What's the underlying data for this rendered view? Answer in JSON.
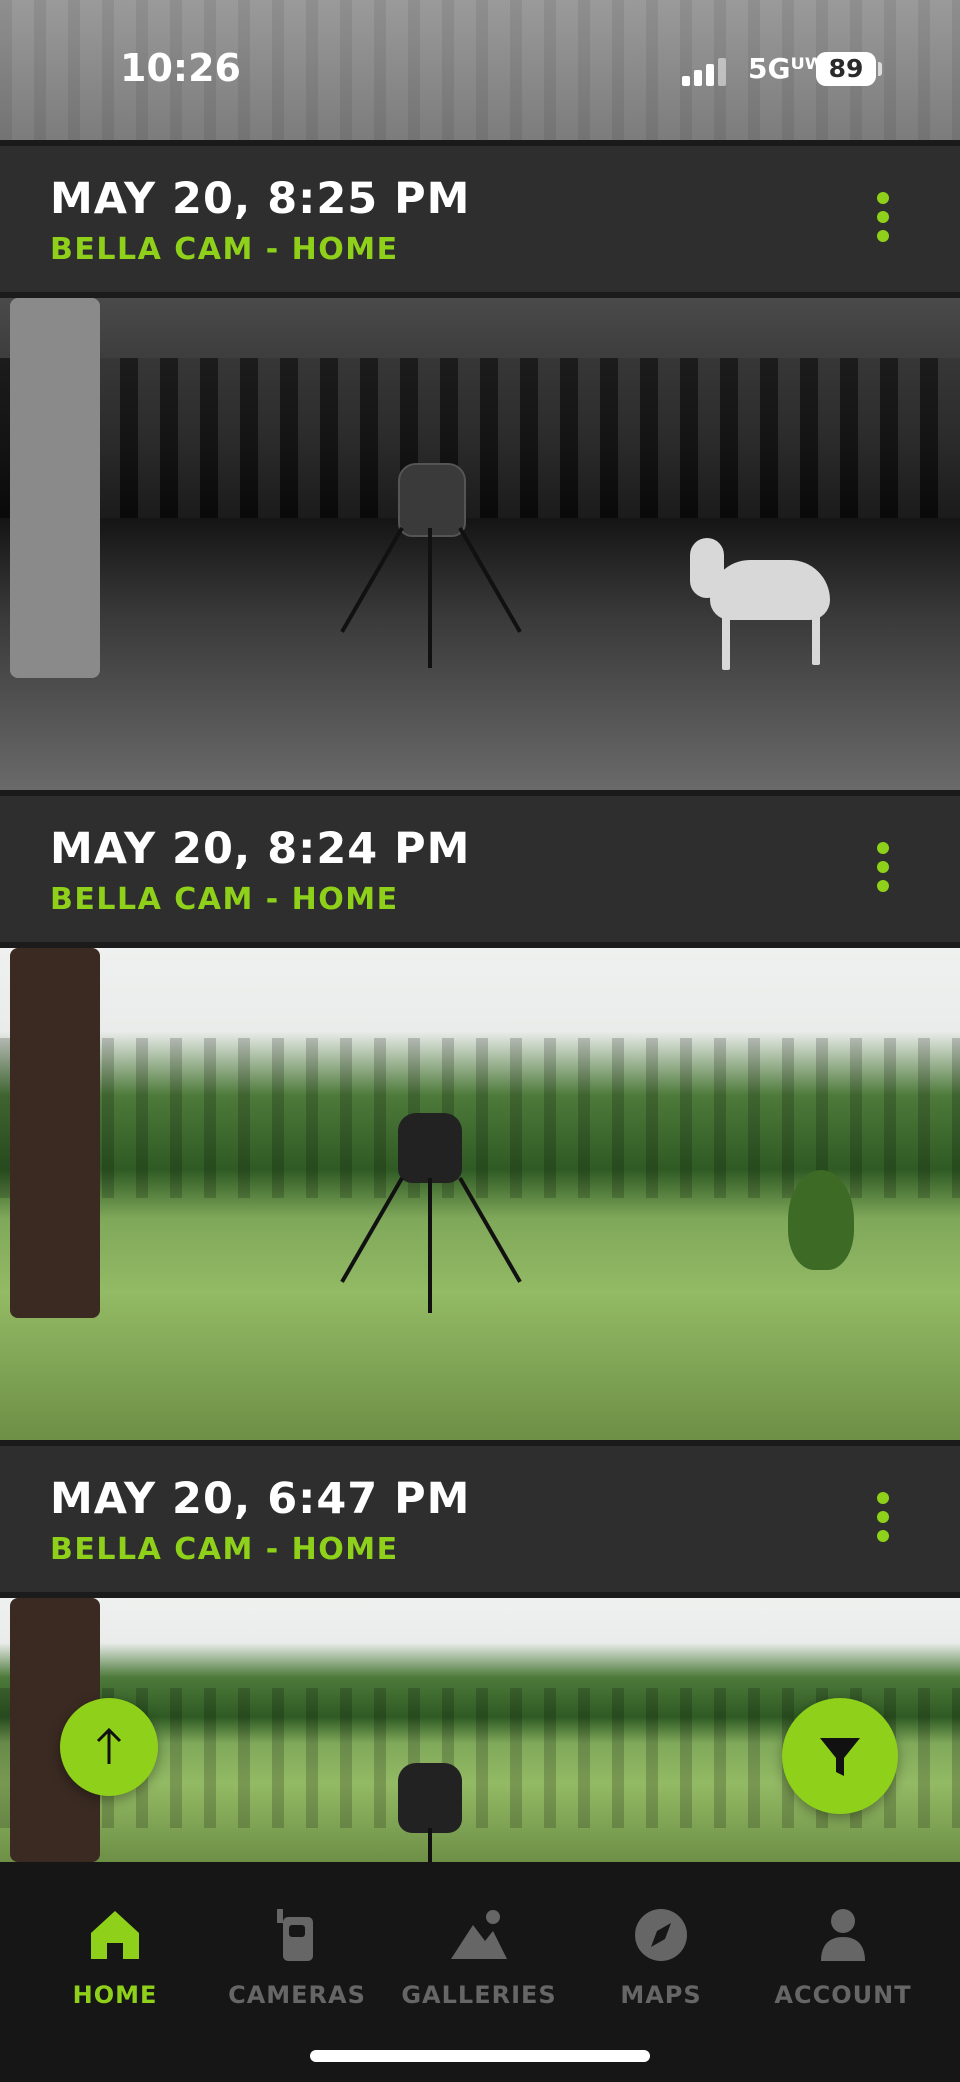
{
  "status_bar": {
    "time": "10:26",
    "network": "5G UW",
    "network_label": "5Gᵁᵂ",
    "battery": "89"
  },
  "events": [
    {
      "date": "MAY 20, 8:25 PM",
      "camera": "BELLA CAM - HOME",
      "image": "infrared night photo: feeder and deer in field"
    },
    {
      "date": "MAY 20, 8:24 PM",
      "camera": "BELLA CAM - HOME",
      "image": "daytime photo: feeder in green field with tree line"
    },
    {
      "date": "MAY 20, 6:47 PM",
      "camera": "BELLA CAM - HOME",
      "image": "daytime photo: feeder in green field with tree line"
    }
  ],
  "fabs": {
    "scroll_top_icon": "arrow-up-icon",
    "filter_icon": "filter-funnel-icon"
  },
  "nav": {
    "items": [
      {
        "label": "HOME",
        "icon": "home-icon",
        "active": true
      },
      {
        "label": "CAMERAS",
        "icon": "camera-icon",
        "active": false
      },
      {
        "label": "GALLERIES",
        "icon": "gallery-icon",
        "active": false
      },
      {
        "label": "MAPS",
        "icon": "compass-icon",
        "active": false
      },
      {
        "label": "ACCOUNT",
        "icon": "account-icon",
        "active": false
      }
    ]
  },
  "colors": {
    "accent": "#8fd11a",
    "card_background": "#2e2e2e",
    "nav_background": "#161616",
    "nav_inactive": "#666666"
  }
}
